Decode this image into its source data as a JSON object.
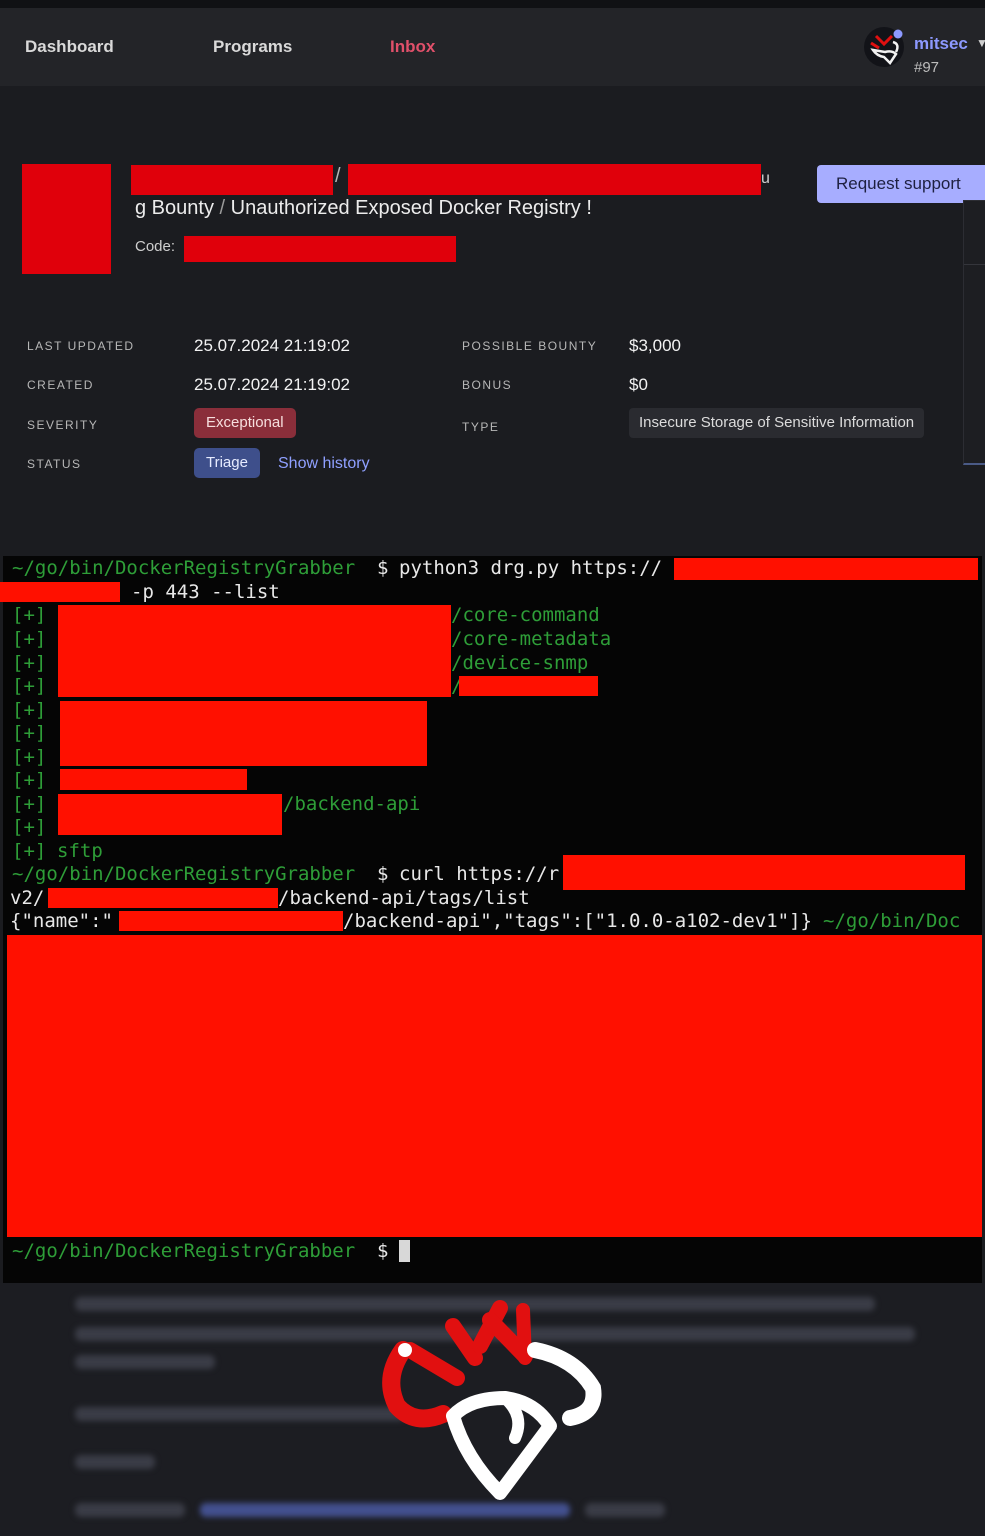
{
  "nav": {
    "items": [
      {
        "label": "Dashboard",
        "active": false
      },
      {
        "label": "Programs",
        "active": false
      },
      {
        "label": "Inbox",
        "active": true
      }
    ],
    "user": {
      "name": "mitsec",
      "rank": "#97",
      "avatar_icon": "mitsec-logo-icon"
    }
  },
  "report": {
    "title_separator": "/",
    "title_fragment_end": "u",
    "title_program_tail": "g Bounty",
    "title_divider": "/",
    "title_name": "Unauthorized Exposed Docker Registry !",
    "code_label": "Code:",
    "support_button": "Request support"
  },
  "meta": {
    "last_updated_label": "LAST UPDATED",
    "last_updated": "25.07.2024 21:19:02",
    "created_label": "CREATED",
    "created": "25.07.2024 21:19:02",
    "severity_label": "SEVERITY",
    "severity": "Exceptional",
    "status_label": "STATUS",
    "status": "Triage",
    "show_history": "Show history",
    "possible_bounty_label": "POSSIBLE BOUNTY",
    "possible_bounty": "$3,000",
    "bonus_label": "BONUS",
    "bonus": "$0",
    "type_label": "TYPE",
    "type": "Insecure Storage of Sensitive Information"
  },
  "terminal": {
    "prompt_path": "~/go/bin/DockerRegistryGrabber",
    "prompt_symbol": "$",
    "cmd1": "python3 drg.py https://",
    "cmd1_cont": "-p 443 --list",
    "bullet": "[+]",
    "repo1": "/core-command",
    "repo2": "/core-metadata",
    "repo3": "/device-snmp",
    "repo4": "/",
    "repo9": "/backend-api",
    "repo11": "sftp",
    "cmd2": "curl https://r",
    "cmd2_cont_prefix": "v2/",
    "cmd2_cont_suffix": "/backend-api/tags/list",
    "resp_prefix": "{\"name\":\"",
    "resp_suffix": "/backend-api\",\"tags\":[\"1.0.0-a102-dev1\"]}",
    "resp_trailing_path": "~/go/bin/Doc"
  },
  "colors": {
    "accent_inbox": "#e0506a",
    "user_name": "#8d99ff",
    "support_button": "#a7adff",
    "severity_badge": "#8a2e3a",
    "status_badge": "#3e4f8b",
    "terminal_green": "#2e9e38",
    "redaction": "#e0000b"
  }
}
